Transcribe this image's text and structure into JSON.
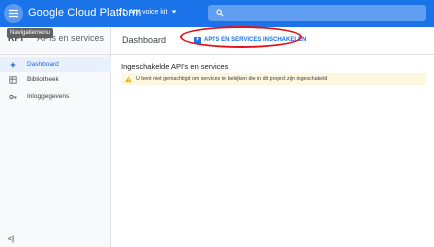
{
  "topbar": {
    "brand": "Google Cloud Platform",
    "project": "AIY voice kit",
    "colors": {
      "bar": "#1a73e8"
    }
  },
  "tooltip": "Navigatiemenu",
  "sidebar": {
    "title": "APIs en services",
    "items": [
      {
        "label": "Dashboard",
        "icon": "dashboard-icon",
        "active": true
      },
      {
        "label": "Bibliotheek",
        "icon": "library-icon",
        "active": false
      },
      {
        "label": "Inloggegevens",
        "icon": "key-icon",
        "active": false
      }
    ],
    "collapse_label": "<|"
  },
  "main": {
    "title": "Dashboard",
    "enable_button": "API'S EN SERVICES INSCHAKELEN",
    "section_title": "Ingeschakelde API's en services",
    "warning": "U bent niet gemachtigd om services te bekijken die in dit project zijn ingeschakeld"
  }
}
